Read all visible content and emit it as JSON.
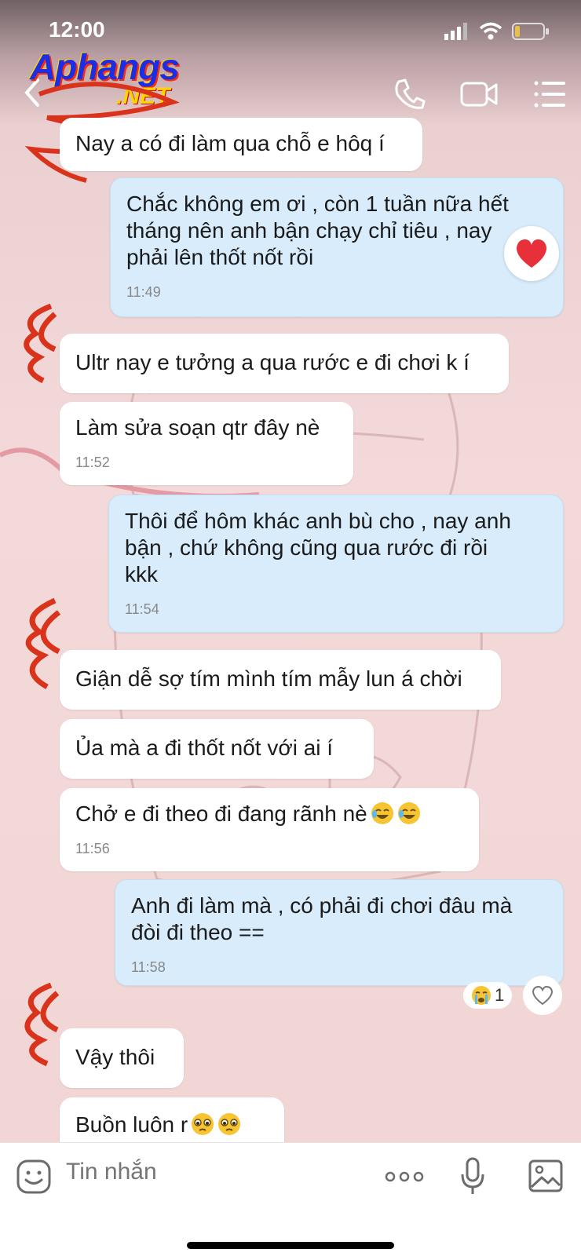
{
  "status_bar": {
    "time": "12:00"
  },
  "logo": {
    "main": "Aphangs",
    "suffix": ".NET"
  },
  "messages": [
    {
      "direction": "in",
      "text": "Nay a có đi làm qua chỗ e hôq í",
      "time": ""
    },
    {
      "direction": "out",
      "text": "Chắc không em ơi , còn 1 tuần nữa hết\ntháng nên anh bận chạy chỉ tiêu , nay\nphải lên thốt nốt rồi",
      "time": "11:49"
    },
    {
      "direction": "in",
      "text": "Ultr nay e tưởng a qua rước e đi chơi k í",
      "time": ""
    },
    {
      "direction": "in",
      "text": "Làm sửa soạn qtr đây nè",
      "time": "11:52"
    },
    {
      "direction": "out",
      "text": "Thôi để hôm khác anh bù cho , nay anh\nbận , chứ không cũng qua rước đi rồi\nkkk",
      "time": "11:54"
    },
    {
      "direction": "in",
      "text": "Giận dễ sợ tím mình tím mẫy lun á chời",
      "time": ""
    },
    {
      "direction": "in",
      "text": "Ủa mà a đi thốt nốt với ai í",
      "time": ""
    },
    {
      "direction": "in",
      "text": "Chở e đi theo đi đang rãnh nè",
      "time": "11:56"
    },
    {
      "direction": "out",
      "text": "Anh đi làm mà , có phải đi chơi đâu mà\nđòi đi theo ==",
      "time": "11:58"
    },
    {
      "direction": "in",
      "text": "Vậy thôi",
      "time": ""
    },
    {
      "direction": "in",
      "text": "Buồn luôn r",
      "time": ""
    }
  ],
  "reaction": {
    "count": "1",
    "emoji_name": "crying-emoji"
  },
  "heart_reaction": {
    "emoji_name": "red-heart-emoji"
  },
  "input": {
    "placeholder": "Tin nhắn"
  },
  "colors": {
    "incoming_bubble": "#ffffff",
    "outgoing_bubble": "#d8ecfb",
    "scribble_red": "#d9331c",
    "icon_gray": "#6b6b6b"
  }
}
